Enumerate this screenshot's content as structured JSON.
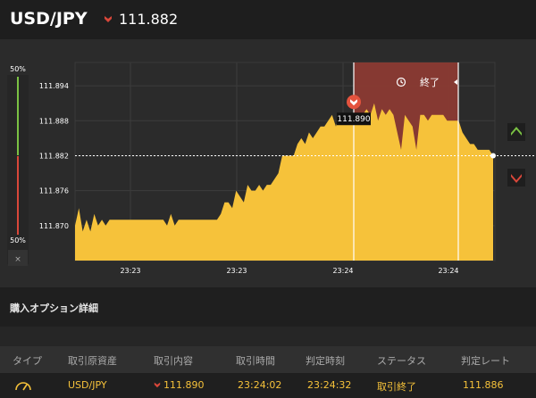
{
  "header": {
    "pair": "USD/JPY",
    "rate": "111.882",
    "direction_icon": "down-arrow-icon"
  },
  "chart": {
    "y_ticks": [
      "111.894",
      "111.888",
      "111.882",
      "111.876",
      "111.870"
    ],
    "x_ticks": [
      "23:23",
      "23:23",
      "23:24",
      "23:24"
    ],
    "side_scale": {
      "top": "50%",
      "bottom": "50%",
      "close": "×"
    },
    "current_rate_line": "111.882",
    "entry_marker_label": "111.890",
    "end_zone_label": "終了",
    "colors": {
      "area": "#f6c23a",
      "end_zone": "#8b3a33",
      "up": "#7ac143",
      "down": "#d9473a"
    }
  },
  "chart_data": {
    "type": "area",
    "ylim": [
      111.864,
      111.898
    ],
    "y_ticks": [
      111.894,
      111.888,
      111.882,
      111.876,
      111.87
    ],
    "x_tick_labels": [
      "23:23",
      "23:23",
      "23:24",
      "23:24"
    ],
    "series": [
      {
        "values": [
          111.87,
          111.873,
          111.869,
          111.871,
          111.869,
          111.872,
          111.87,
          111.871,
          111.87,
          111.871,
          111.871,
          111.871,
          111.871,
          111.871,
          111.871,
          111.871,
          111.871,
          111.871,
          111.871,
          111.871,
          111.871,
          111.871,
          111.871,
          111.871,
          111.87,
          111.872,
          111.87,
          111.871,
          111.871,
          111.871,
          111.871,
          111.871,
          111.871,
          111.871,
          111.871,
          111.871,
          111.871,
          111.871,
          111.872,
          111.874,
          111.874,
          111.873,
          111.876,
          111.875,
          111.874,
          111.877,
          111.876,
          111.876,
          111.877,
          111.876,
          111.877,
          111.877,
          111.878,
          111.879,
          111.882,
          111.882,
          111.882,
          111.882,
          111.884,
          111.885,
          111.884,
          111.886,
          111.885,
          111.886,
          111.887,
          111.887,
          111.888,
          111.889,
          111.887,
          111.889,
          111.889,
          111.888,
          111.889,
          111.889,
          111.888,
          111.889,
          111.89,
          111.889,
          111.891,
          111.888,
          111.89,
          111.889,
          111.89,
          111.889,
          111.886,
          111.883,
          111.889,
          111.888,
          111.887,
          111.883,
          111.889,
          111.889,
          111.888,
          111.889,
          111.889,
          111.889,
          111.889,
          111.888,
          111.888,
          111.888,
          111.888,
          111.886,
          111.885,
          111.884,
          111.884,
          111.883,
          111.883,
          111.883,
          111.883,
          111.882
        ]
      }
    ],
    "current_rate": 111.882,
    "entry_rate": 111.89
  },
  "details": {
    "title": "購入オプション詳細",
    "columns": [
      "タイプ",
      "取引原資産",
      "取引内容",
      "取引時間",
      "判定時刻",
      "ステータス",
      "判定レート"
    ],
    "row": {
      "type_icon": "gauge-icon",
      "asset": "USD/JPY",
      "content": "111.890",
      "trade_time": "23:24:02",
      "judge_time": "23:24:32",
      "status": "取引終了",
      "judge_rate": "111.886"
    }
  }
}
